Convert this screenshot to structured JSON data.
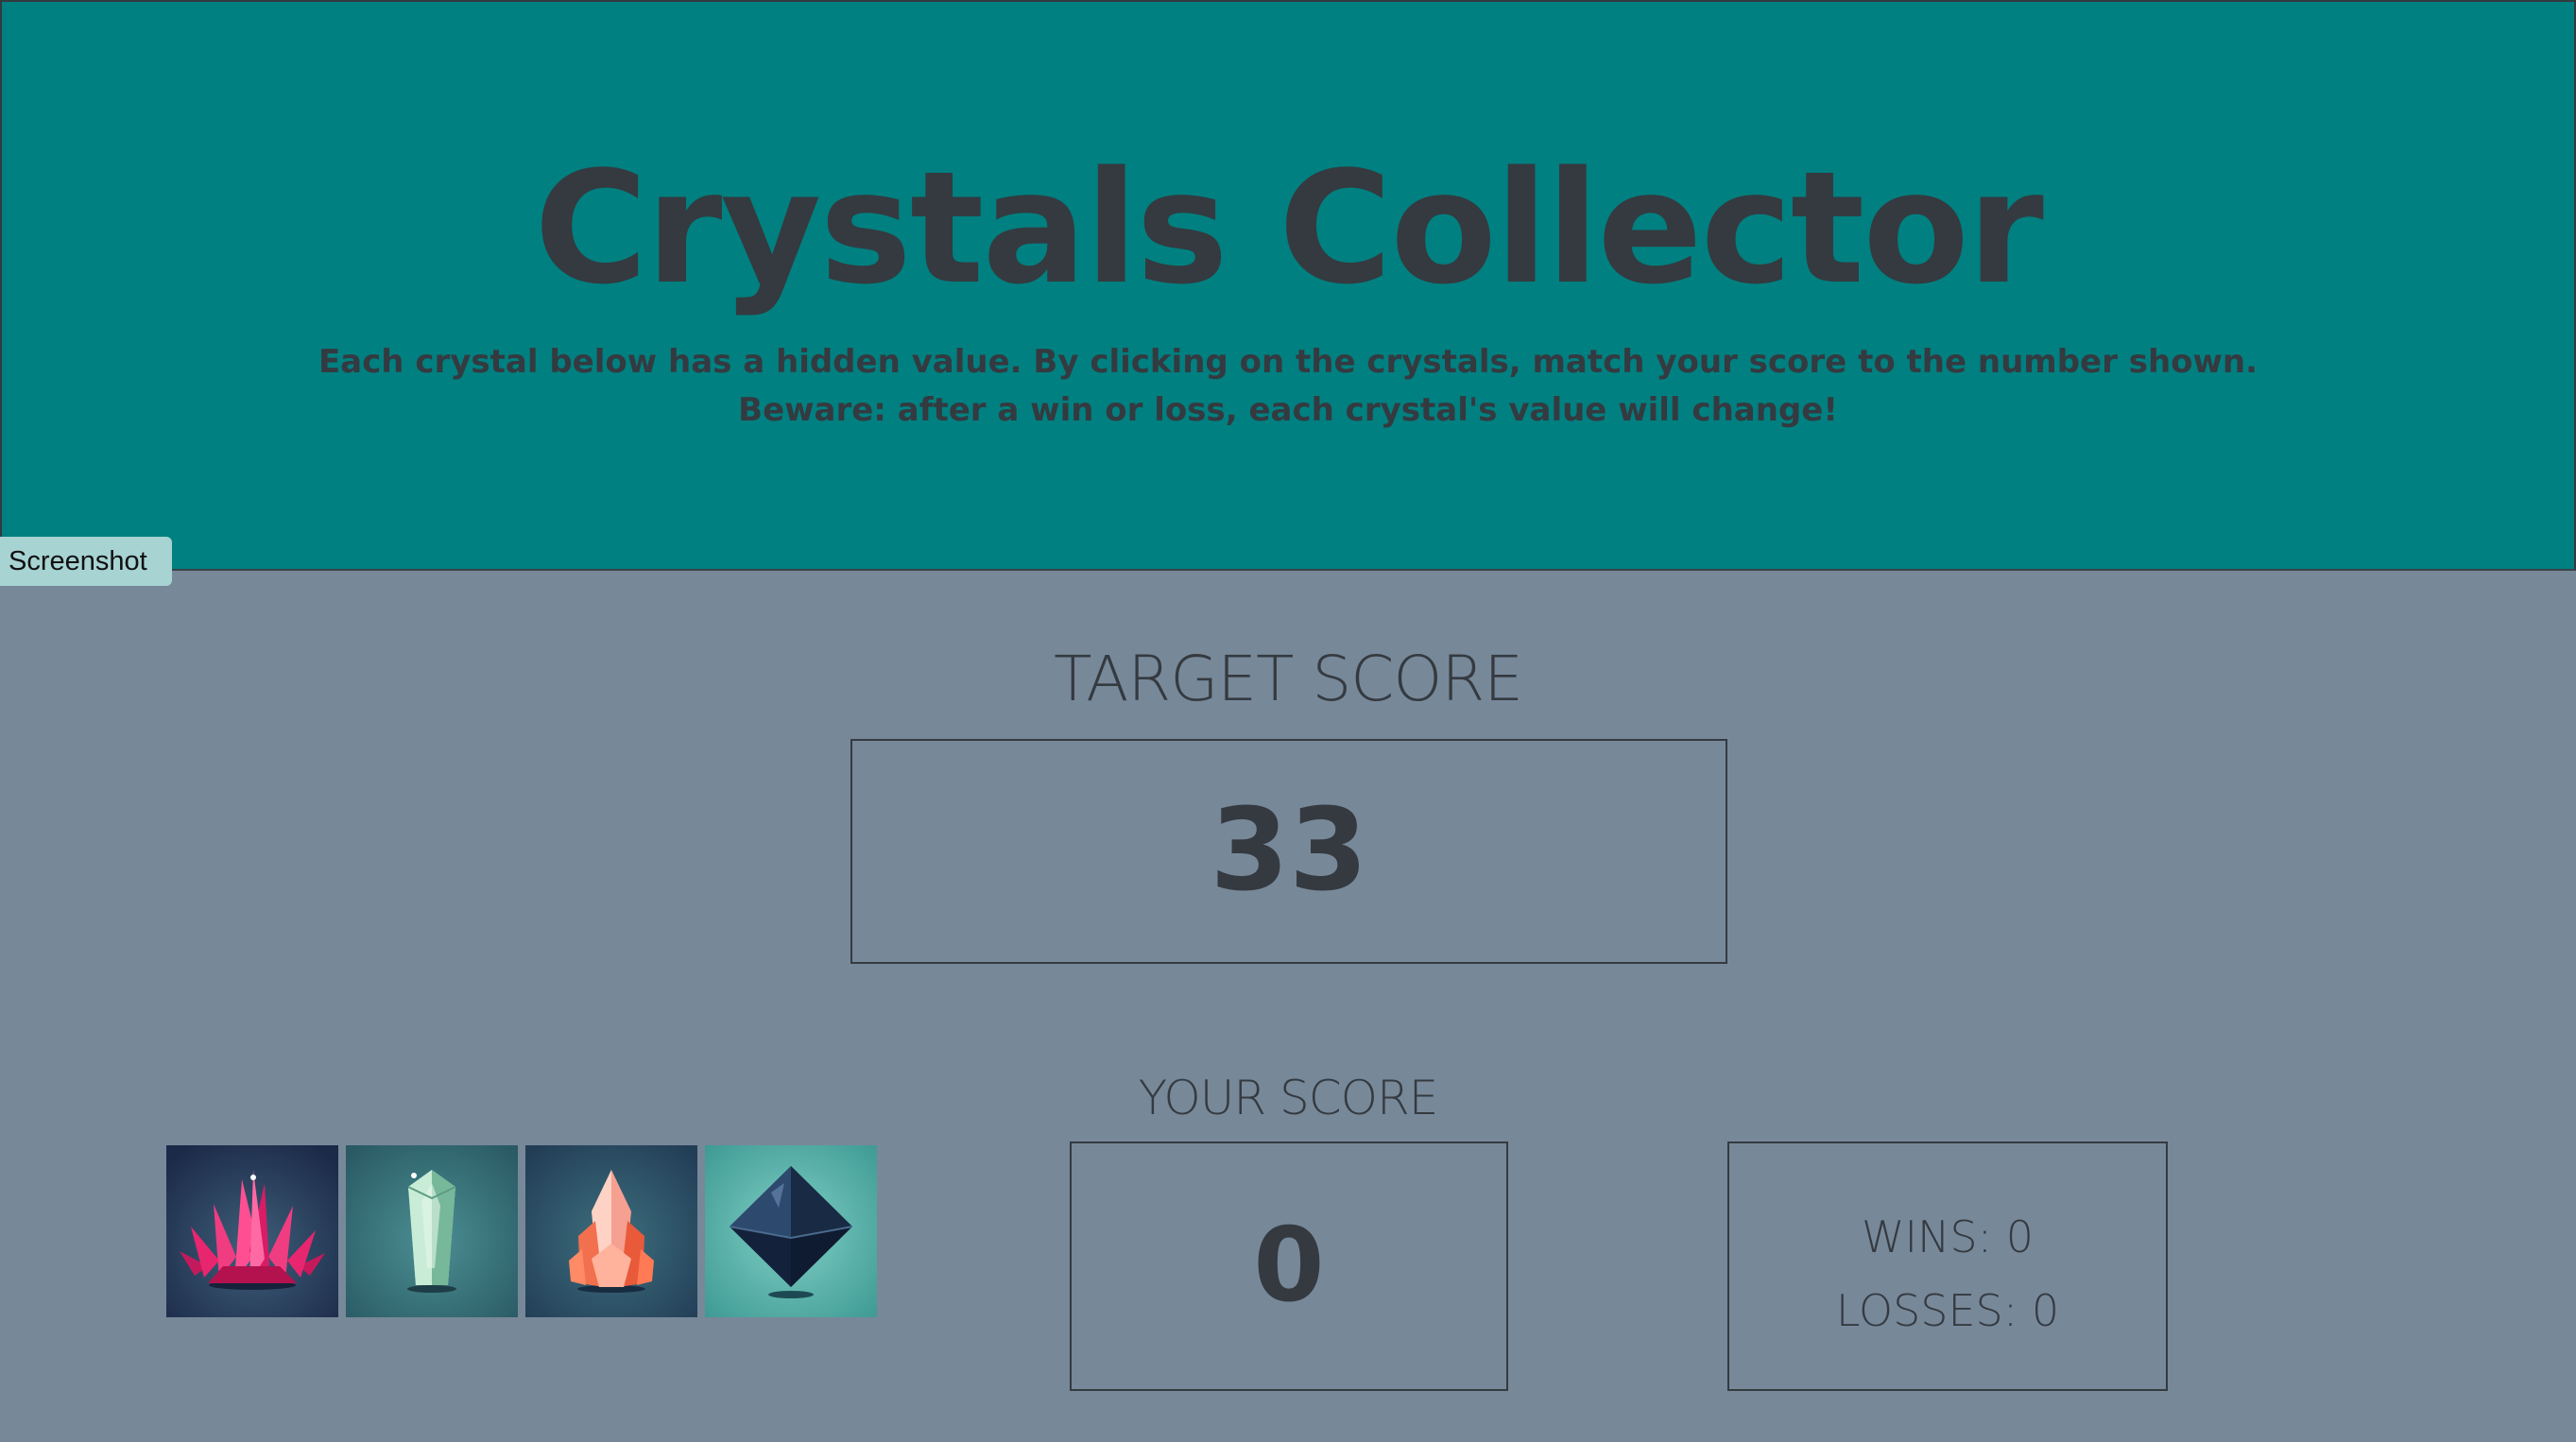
{
  "header": {
    "title": "Crystals Collector",
    "instructions_line1": "Each crystal below has a hidden value. By clicking on the crystals, match your score to the number shown.",
    "instructions_line2": "Beware: after a win or loss, each crystal's value will change!"
  },
  "overlay": {
    "screenshot_tab": "Screenshot"
  },
  "game": {
    "target_label": "TARGET SCORE",
    "target_score": "33",
    "your_score_label": "YOUR SCORE",
    "your_score": "0",
    "wins_text": "WINS: 0",
    "losses_text": "LOSSES: 0"
  },
  "crystals": [
    {
      "icon": "pink-crystal-cluster-icon",
      "color": "#e8266f"
    },
    {
      "icon": "green-crystal-shard-icon",
      "color": "#9fd6b8"
    },
    {
      "icon": "orange-crystal-icon",
      "color": "#f2704e"
    },
    {
      "icon": "dark-octahedron-crystal-icon",
      "color": "#1f3350"
    }
  ],
  "colors": {
    "header_bg": "#008080",
    "body_bg": "#778899",
    "text": "#343a40"
  }
}
